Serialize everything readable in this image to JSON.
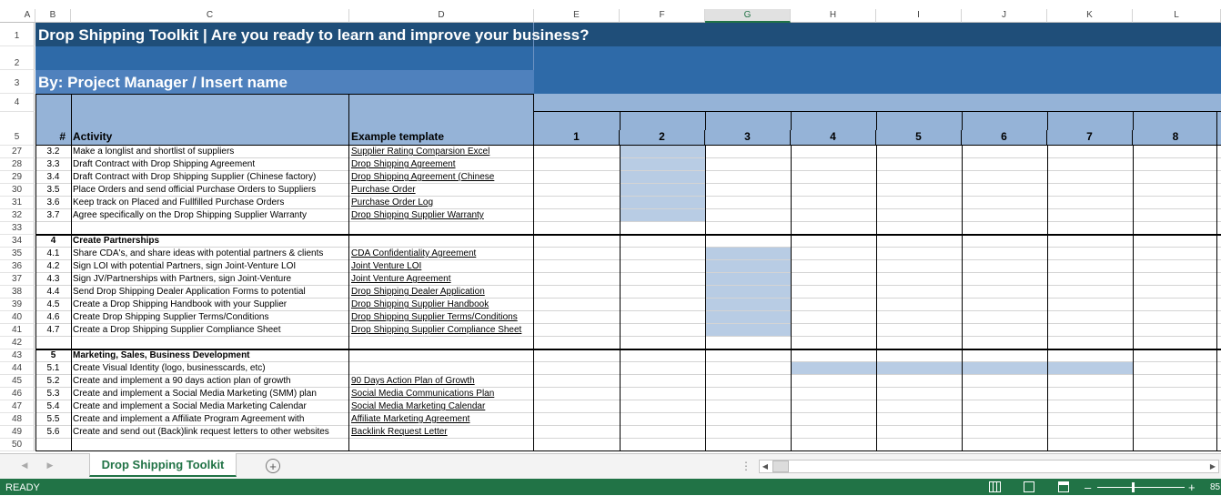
{
  "columns": [
    "A",
    "B",
    "C",
    "D",
    "E",
    "F",
    "G",
    "H",
    "I",
    "J",
    "K",
    "L"
  ],
  "title": "Drop Shipping Toolkit | Are you ready to learn and improve your business?",
  "subtitle": "By: Project Manager / Insert name",
  "header": {
    "hash": "#",
    "activity": "Activity",
    "template": "Example template",
    "weeks": [
      "1",
      "2",
      "3",
      "4",
      "5",
      "6",
      "7",
      "8"
    ]
  },
  "top_rows": [
    "1",
    "2",
    "3",
    "4",
    "5"
  ],
  "rows": [
    {
      "n": "27",
      "id": "3.2",
      "activity": "Make a longlist and shortlist of suppliers",
      "template": "Supplier Rating Comparsion Excel"
    },
    {
      "n": "28",
      "id": "3.3",
      "activity": "Draft Contract with Drop Shipping Agreement",
      "template": "Drop Shipping Agreement"
    },
    {
      "n": "29",
      "id": "3.4",
      "activity": "Draft Contract with Drop Shipping Supplier (Chinese factory)",
      "template": "Drop Shipping Agreement (Chinese"
    },
    {
      "n": "30",
      "id": "3.5",
      "activity": "Place Orders and send official Purchase Orders to Suppliers",
      "template": "Purchase Order"
    },
    {
      "n": "31",
      "id": "3.6",
      "activity": "Keep track on Placed and Fullfilled Purchase Orders",
      "template": "Purchase Order Log"
    },
    {
      "n": "32",
      "id": "3.7",
      "activity": "Agree specifically on the Drop Shipping Supplier Warranty",
      "template": "Drop Shipping Supplier Warranty"
    },
    {
      "n": "33",
      "id": "",
      "activity": "",
      "template": ""
    },
    {
      "n": "34",
      "id": "4",
      "activity": "Create Partnerships",
      "template": "",
      "section": true
    },
    {
      "n": "35",
      "id": "4.1",
      "activity": "Share CDA's, and share ideas with potential partners & clients",
      "template": "CDA Confidentiality Agreement"
    },
    {
      "n": "36",
      "id": "4.2",
      "activity": "Sign LOI with potential Partners,  sign Joint-Venture LOI",
      "template": "Joint Venture LOI"
    },
    {
      "n": "37",
      "id": "4.3",
      "activity": "Sign JV/Partnerships with Partners,  sign Joint-Venture",
      "template": "Joint Venture Agreement"
    },
    {
      "n": "38",
      "id": "4.4",
      "activity": "Send Drop Shipping Dealer Application Forms to potential",
      "template": "Drop Shipping Dealer Application"
    },
    {
      "n": "39",
      "id": "4.5",
      "activity": "Create a Drop Shipping Handbook with your Supplier",
      "template": "Drop Shipping Supplier Handbook"
    },
    {
      "n": "40",
      "id": "4.6",
      "activity": "Create Drop Shipping Supplier Terms/Conditions",
      "template": "Drop Shipping Supplier Terms/Conditions"
    },
    {
      "n": "41",
      "id": "4.7",
      "activity": "Create a Drop Shipping Supplier Compliance Sheet",
      "template": "Drop Shipping Supplier Compliance Sheet"
    },
    {
      "n": "42",
      "id": "",
      "activity": "",
      "template": ""
    },
    {
      "n": "43",
      "id": "5",
      "activity": "Marketing, Sales, Business Development",
      "template": "",
      "section": true
    },
    {
      "n": "44",
      "id": "5.1",
      "activity": "Create Visual Identity (logo, businesscards, etc)",
      "template": ""
    },
    {
      "n": "45",
      "id": "5.2",
      "activity": "Create and implement a 90 days action plan of growth",
      "template": "90 Days Action Plan of Growth"
    },
    {
      "n": "46",
      "id": "5.3",
      "activity": "Create and implement a Social Media Marketing (SMM) plan",
      "template": "Social Media Communications Plan"
    },
    {
      "n": "47",
      "id": "5.4",
      "activity": "Create and implement a Social Media Marketing Calendar",
      "template": "Social Media Marketing Calendar"
    },
    {
      "n": "48",
      "id": "5.5",
      "activity": "Create and implement a Affiliate Program Agreement with",
      "template": "Affiliate Marketing Agreement"
    },
    {
      "n": "49",
      "id": "5.6",
      "activity": "Create and send out (Back)link request letters to other websites",
      "template": "Backlink Request Letter"
    },
    {
      "n": "50",
      "id": "",
      "activity": "",
      "template": ""
    }
  ],
  "sheet_tab": "Drop Shipping Toolkit",
  "status": "READY",
  "zoom": "85",
  "colors": {
    "dark_blue": "#1f4e79",
    "mid_blue": "#4f81bd",
    "light_blue": "#b8cce4",
    "header_blue": "#95b3d7",
    "excel_green": "#217346"
  }
}
